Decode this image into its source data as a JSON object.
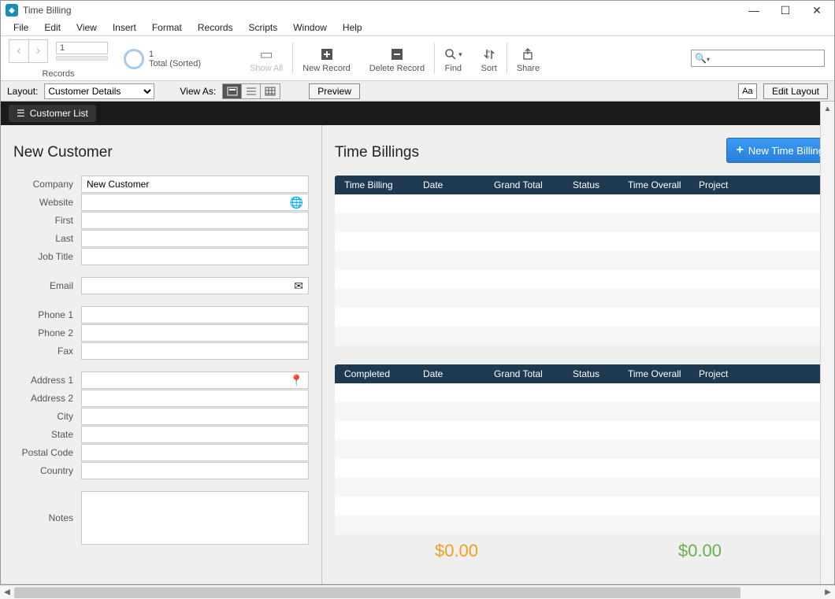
{
  "window": {
    "title": "Time Billing"
  },
  "menu": {
    "file": "File",
    "edit": "Edit",
    "view": "View",
    "insert": "Insert",
    "format": "Format",
    "records": "Records",
    "scripts": "Scripts",
    "window": "Window",
    "help": "Help"
  },
  "toolbar": {
    "current_record": "1",
    "records_label": "Records",
    "total_count": "1",
    "total_label": "Total (Sorted)",
    "showall": "Show All",
    "newrecord": "New Record",
    "deleterecord": "Delete Record",
    "find": "Find",
    "sort": "Sort",
    "share": "Share"
  },
  "layoutbar": {
    "layout_label": "Layout:",
    "layout_value": "Customer Details",
    "viewas_label": "View As:",
    "preview": "Preview",
    "aa": "Aa",
    "editlayout": "Edit Layout"
  },
  "blackbar": {
    "customerlist": "Customer List"
  },
  "left": {
    "heading": "New Customer",
    "labels": {
      "company": "Company",
      "website": "Website",
      "first": "First",
      "last": "Last",
      "jobtitle": "Job Title",
      "email": "Email",
      "phone1": "Phone 1",
      "phone2": "Phone 2",
      "fax": "Fax",
      "address1": "Address 1",
      "address2": "Address 2",
      "city": "City",
      "state": "State",
      "postal": "Postal Code",
      "country": "Country",
      "notes": "Notes"
    },
    "values": {
      "company": "New Customer",
      "website": "",
      "first": "",
      "last": "",
      "jobtitle": "",
      "email": "",
      "phone1": "",
      "phone2": "",
      "fax": "",
      "address1": "",
      "address2": "",
      "city": "",
      "state": "",
      "postal": "",
      "country": "",
      "notes": ""
    }
  },
  "right": {
    "heading": "Time Billings",
    "newtimebilling": "New Time Billing",
    "table1": {
      "cols": {
        "c1": "Time Billing",
        "c2": "Date",
        "c3": "Grand Total",
        "c4": "Status",
        "c5": "Time Overall",
        "c6": "Project"
      }
    },
    "table2": {
      "cols": {
        "c1": "Completed",
        "c2": "Date",
        "c3": "Grand Total",
        "c4": "Status",
        "c5": "Time Overall",
        "c6": "Project"
      }
    },
    "totals": {
      "orange": "$0.00",
      "green": "$0.00"
    }
  }
}
